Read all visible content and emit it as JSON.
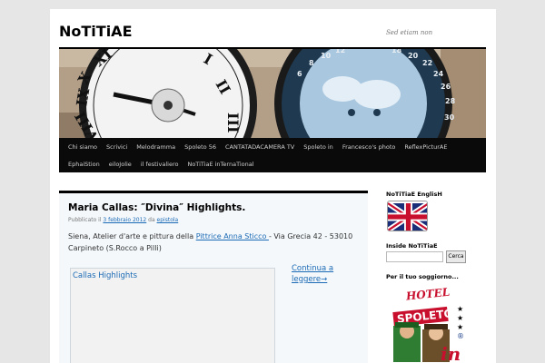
{
  "site": {
    "title": "NoTiTiAE",
    "description": "Sed etiam non"
  },
  "menu": {
    "row1": [
      "Chi siamo",
      "Scrivici",
      "Melodramma",
      "Spoleto 56",
      "CANTATADACAMERA TV",
      "Spoleto in",
      "Francesco's photo",
      "ReflexPicturAE"
    ],
    "row2": [
      "EphaiStion",
      "eiloJolie",
      "il festivaliero",
      "NoTiTiaE inTernaTional"
    ]
  },
  "post": {
    "title": "Maria Callas: ″Divina″ Highlights.",
    "meta_prefix": "Pubblicato il ",
    "date": "3 febbraio 2012",
    "meta_mid": " da ",
    "author": "epistola",
    "text_before": "Siena, Atelier d'arte e pittura della ",
    "link_text": "Pittrice Anna Sticco ",
    "text_after": "- Via Grecia 42 - 53010 Carpineto (S.Rocco a Pilli)",
    "video_title": "Callas Highlights",
    "continue": "Continua a leggere→"
  },
  "sidebar": {
    "english_title": "NoTiTiaE EnglisH",
    "inside_title": "Inside NoTiTiaE",
    "search_button": "Cerca",
    "stay_title": "Per il tuo soggiorno...",
    "hotel_line1": "HOTEL",
    "hotel_line2": "SPOLETO",
    "hotel_in": "in"
  },
  "colors": {
    "link": "#1b6ab5",
    "menu_bg": "#0a0a0a",
    "content_bg": "#f4f8fb"
  }
}
